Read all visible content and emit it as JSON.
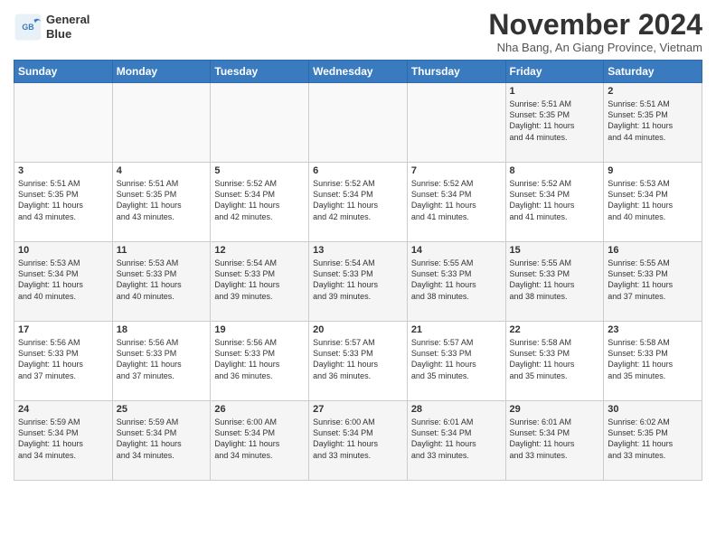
{
  "logo": {
    "text_line1": "General",
    "text_line2": "Blue"
  },
  "header": {
    "month": "November 2024",
    "location": "Nha Bang, An Giang Province, Vietnam"
  },
  "days_of_week": [
    "Sunday",
    "Monday",
    "Tuesday",
    "Wednesday",
    "Thursday",
    "Friday",
    "Saturday"
  ],
  "weeks": [
    [
      {
        "day": "",
        "info": ""
      },
      {
        "day": "",
        "info": ""
      },
      {
        "day": "",
        "info": ""
      },
      {
        "day": "",
        "info": ""
      },
      {
        "day": "",
        "info": ""
      },
      {
        "day": "1",
        "info": "Sunrise: 5:51 AM\nSunset: 5:35 PM\nDaylight: 11 hours\nand 44 minutes."
      },
      {
        "day": "2",
        "info": "Sunrise: 5:51 AM\nSunset: 5:35 PM\nDaylight: 11 hours\nand 44 minutes."
      }
    ],
    [
      {
        "day": "3",
        "info": "Sunrise: 5:51 AM\nSunset: 5:35 PM\nDaylight: 11 hours\nand 43 minutes."
      },
      {
        "day": "4",
        "info": "Sunrise: 5:51 AM\nSunset: 5:35 PM\nDaylight: 11 hours\nand 43 minutes."
      },
      {
        "day": "5",
        "info": "Sunrise: 5:52 AM\nSunset: 5:34 PM\nDaylight: 11 hours\nand 42 minutes."
      },
      {
        "day": "6",
        "info": "Sunrise: 5:52 AM\nSunset: 5:34 PM\nDaylight: 11 hours\nand 42 minutes."
      },
      {
        "day": "7",
        "info": "Sunrise: 5:52 AM\nSunset: 5:34 PM\nDaylight: 11 hours\nand 41 minutes."
      },
      {
        "day": "8",
        "info": "Sunrise: 5:52 AM\nSunset: 5:34 PM\nDaylight: 11 hours\nand 41 minutes."
      },
      {
        "day": "9",
        "info": "Sunrise: 5:53 AM\nSunset: 5:34 PM\nDaylight: 11 hours\nand 40 minutes."
      }
    ],
    [
      {
        "day": "10",
        "info": "Sunrise: 5:53 AM\nSunset: 5:34 PM\nDaylight: 11 hours\nand 40 minutes."
      },
      {
        "day": "11",
        "info": "Sunrise: 5:53 AM\nSunset: 5:33 PM\nDaylight: 11 hours\nand 40 minutes."
      },
      {
        "day": "12",
        "info": "Sunrise: 5:54 AM\nSunset: 5:33 PM\nDaylight: 11 hours\nand 39 minutes."
      },
      {
        "day": "13",
        "info": "Sunrise: 5:54 AM\nSunset: 5:33 PM\nDaylight: 11 hours\nand 39 minutes."
      },
      {
        "day": "14",
        "info": "Sunrise: 5:55 AM\nSunset: 5:33 PM\nDaylight: 11 hours\nand 38 minutes."
      },
      {
        "day": "15",
        "info": "Sunrise: 5:55 AM\nSunset: 5:33 PM\nDaylight: 11 hours\nand 38 minutes."
      },
      {
        "day": "16",
        "info": "Sunrise: 5:55 AM\nSunset: 5:33 PM\nDaylight: 11 hours\nand 37 minutes."
      }
    ],
    [
      {
        "day": "17",
        "info": "Sunrise: 5:56 AM\nSunset: 5:33 PM\nDaylight: 11 hours\nand 37 minutes."
      },
      {
        "day": "18",
        "info": "Sunrise: 5:56 AM\nSunset: 5:33 PM\nDaylight: 11 hours\nand 37 minutes."
      },
      {
        "day": "19",
        "info": "Sunrise: 5:56 AM\nSunset: 5:33 PM\nDaylight: 11 hours\nand 36 minutes."
      },
      {
        "day": "20",
        "info": "Sunrise: 5:57 AM\nSunset: 5:33 PM\nDaylight: 11 hours\nand 36 minutes."
      },
      {
        "day": "21",
        "info": "Sunrise: 5:57 AM\nSunset: 5:33 PM\nDaylight: 11 hours\nand 35 minutes."
      },
      {
        "day": "22",
        "info": "Sunrise: 5:58 AM\nSunset: 5:33 PM\nDaylight: 11 hours\nand 35 minutes."
      },
      {
        "day": "23",
        "info": "Sunrise: 5:58 AM\nSunset: 5:33 PM\nDaylight: 11 hours\nand 35 minutes."
      }
    ],
    [
      {
        "day": "24",
        "info": "Sunrise: 5:59 AM\nSunset: 5:34 PM\nDaylight: 11 hours\nand 34 minutes."
      },
      {
        "day": "25",
        "info": "Sunrise: 5:59 AM\nSunset: 5:34 PM\nDaylight: 11 hours\nand 34 minutes."
      },
      {
        "day": "26",
        "info": "Sunrise: 6:00 AM\nSunset: 5:34 PM\nDaylight: 11 hours\nand 34 minutes."
      },
      {
        "day": "27",
        "info": "Sunrise: 6:00 AM\nSunset: 5:34 PM\nDaylight: 11 hours\nand 33 minutes."
      },
      {
        "day": "28",
        "info": "Sunrise: 6:01 AM\nSunset: 5:34 PM\nDaylight: 11 hours\nand 33 minutes."
      },
      {
        "day": "29",
        "info": "Sunrise: 6:01 AM\nSunset: 5:34 PM\nDaylight: 11 hours\nand 33 minutes."
      },
      {
        "day": "30",
        "info": "Sunrise: 6:02 AM\nSunset: 5:35 PM\nDaylight: 11 hours\nand 33 minutes."
      }
    ]
  ]
}
